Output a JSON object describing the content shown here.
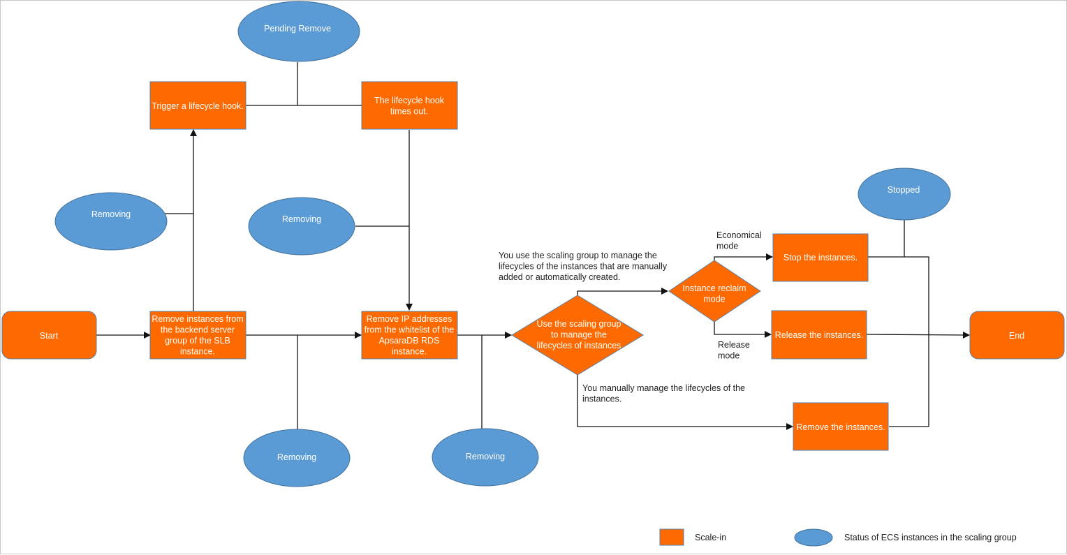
{
  "colors": {
    "process": "#ff6a00",
    "process_border": "#5b7fa6",
    "status": "#5b9bd5",
    "status_border": "#41719c",
    "edge": "#111111",
    "node_text": "#ffffff",
    "label_text": "#222222"
  },
  "nodes": {
    "start": "Start",
    "end": "End",
    "pending_remove": "Pending Remove",
    "trigger_hook": [
      "Trigger a lifecycle hook."
    ],
    "hook_timeout": [
      "The lifecycle hook",
      "times out."
    ],
    "remove_slb": [
      "Remove instances from",
      "the backend server",
      "group of the SLB",
      "instance."
    ],
    "remove_rds": [
      "Remove IP addresses",
      "from the whitelist of the",
      "ApsaraDB RDS",
      "instance."
    ],
    "use_scaling_group": [
      "Use the scaling group",
      "to manage the",
      "lifecycles of instances"
    ],
    "reclaim_mode": [
      "Instance reclaim",
      "mode"
    ],
    "stop_instances": [
      "Stop the instances."
    ],
    "release_instances": [
      "Release the instances."
    ],
    "remove_instances": [
      "Remove the instances."
    ],
    "removing_1": "Removing",
    "removing_2": "Removing",
    "removing_3": "Removing",
    "removing_4": "Removing",
    "stopped": "Stopped"
  },
  "edge_labels": {
    "managed": [
      "You use the scaling group to manage the",
      "lifecycles of the instances that are manually",
      "added or automatically created."
    ],
    "manual": [
      "You manually manage the lifecycles of the",
      "instances."
    ],
    "economical": [
      "Economical",
      "mode"
    ],
    "release": [
      "Release",
      "mode"
    ]
  },
  "legend": {
    "scale_in": "Scale-in",
    "status": "Status of ECS instances in the scaling group"
  }
}
